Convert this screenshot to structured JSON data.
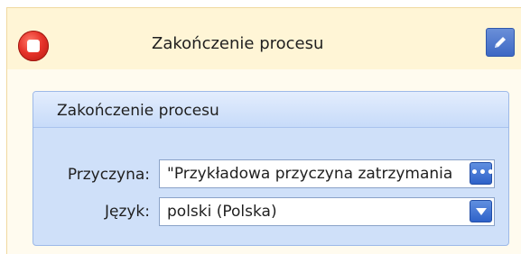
{
  "header": {
    "title": "Zakończenie procesu",
    "stop_icon": "stop-icon",
    "edit_icon": "pencil-icon"
  },
  "group": {
    "title": "Zakończenie procesu",
    "fields": {
      "reason": {
        "label": "Przyczyna:",
        "value": "\"Przykładowa przyczyna zatrzymania",
        "button": "•••"
      },
      "language": {
        "label": "Język:",
        "value": "polski (Polska)"
      }
    }
  },
  "colors": {
    "header_bg": "#fff5d6",
    "group_bg": "#cfe0f9",
    "accent_blue": "#3d68c4",
    "stop_red": "#e6332a"
  }
}
